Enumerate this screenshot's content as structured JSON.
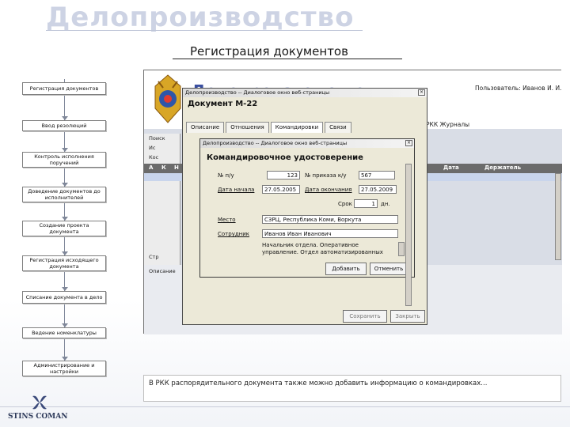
{
  "slide": {
    "title": "Делопроизводство",
    "subtitle": "Регистрация документов",
    "caption": "В РКК распорядительного документа также можно добавить информацию о командировках..."
  },
  "flow": {
    "steps": [
      "Регистрация документов",
      "Ввод резолюций",
      "Контроль исполнения поручений",
      "Доведение документов до исполнителей",
      "Создание проекта документа",
      "Регистрация исходящего документа",
      "Списание документа в дело",
      "Ведение номенклатуры",
      "Администрирование и настройки"
    ]
  },
  "app": {
    "header_title": "Делопроизводство",
    "user_label": "Пользователь: Иванов И. И.",
    "menu_items": "РКК  Журналы",
    "grid_columns": [
      "А",
      "К",
      "Н",
      "Дата",
      "Держатель"
    ],
    "side_items": [
      "Поиск",
      "Ис",
      "Кос",
      "Стр"
    ],
    "bottom_tab": "Описание",
    "window1": {
      "title": "Делопроизводство -- Диалоговое окно веб-страницы",
      "doc_title": "Документ М-22",
      "tabs": [
        "Описание",
        "Отношения",
        "Командировки",
        "Связи"
      ],
      "buttons": [
        "Сохранить",
        "Закрыть"
      ]
    },
    "window2": {
      "title": "Делопроизводство -- Диалоговое окно веб-страницы",
      "form_title": "Командировочное удостоверение",
      "num_label": "№ п/у",
      "num_value": "123",
      "order_label": "№ приказа к/у",
      "order_value": "567",
      "start_label": "Дата начала",
      "start_value": "27.05.2005",
      "end_label": "Дата окончания",
      "end_value": "27.05.2009",
      "term_label": "Срок",
      "term_value": "1",
      "term_unit": "дн.",
      "place_label": "Место",
      "place_value": "СЗРЦ, Республика Коми, Воркута",
      "employee_label": "Сотрудник",
      "employee_value": "Иванов Иван Иванович",
      "dept_text": "Начальник отдела. Оперативное управление. Отдел автоматизированных",
      "add_button": "Добавить",
      "cancel_button": "Отменить"
    }
  },
  "logo": {
    "text": "STINS COMAN"
  },
  "colors": {
    "title_color": "#cdd3e4",
    "app_title_color": "#3a4fa0",
    "grid_header": "#6b6b6b"
  }
}
